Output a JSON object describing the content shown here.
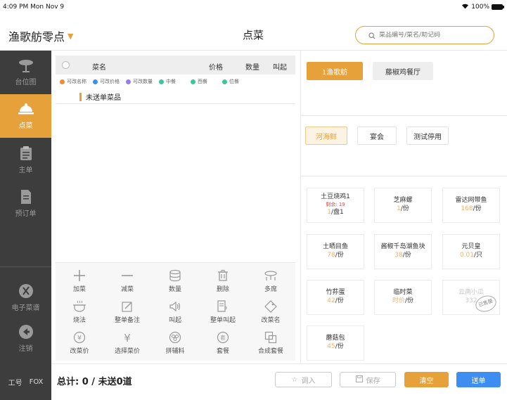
{
  "status_bar": {
    "time": "4:09 PM",
    "date": "Mon Nov 9",
    "battery": "100%"
  },
  "header": {
    "store_name": "渔歌舫零点",
    "title": "点菜",
    "search_placeholder": "菜品编号/菜名/助记码"
  },
  "sidebar": {
    "items": [
      {
        "label": "台位图",
        "icon": "table-icon"
      },
      {
        "label": "点菜",
        "icon": "dish-cover-icon",
        "active": true
      },
      {
        "label": "主单",
        "icon": "clipboard-icon"
      },
      {
        "label": "预订单",
        "icon": "document-icon"
      },
      {
        "label": "电子菜谱",
        "icon": "fork-knife-icon"
      },
      {
        "label": "注销",
        "icon": "logout-icon"
      }
    ],
    "footer": {
      "label": "工号",
      "user": "FOX"
    }
  },
  "order": {
    "columns": {
      "name": "菜名",
      "price": "价格",
      "qty": "数量",
      "call": "叫起"
    },
    "legend": [
      {
        "label": "可改名称",
        "color": "#f28a3c"
      },
      {
        "label": "可改价格",
        "color": "#3d8ef0"
      },
      {
        "label": "可改数量",
        "color": "#9b7be8"
      },
      {
        "label": "中餐",
        "color": "#3cc4a0"
      },
      {
        "label": "西餐",
        "color": "#3cc4a0"
      },
      {
        "label": "位餐",
        "color": "#3cc4a0"
      }
    ],
    "unsent_label": "未送单菜品"
  },
  "actions": [
    {
      "label": "加菜",
      "icon": "plus-icon"
    },
    {
      "label": "减菜",
      "icon": "minus-icon"
    },
    {
      "label": "数量",
      "icon": "stack-icon"
    },
    {
      "label": "删除",
      "icon": "trash-icon"
    },
    {
      "label": "多席",
      "icon": "multi-table-icon"
    },
    {
      "label": "烧法",
      "icon": "pot-icon"
    },
    {
      "label": "整单备注",
      "icon": "edit-icon"
    },
    {
      "label": "叫起",
      "icon": "speaker-icon"
    },
    {
      "label": "整单叫起",
      "icon": "order-speaker-icon"
    },
    {
      "label": "改菜名",
      "icon": "tag-icon"
    },
    {
      "label": "改菜价",
      "icon": "yen-circle-icon"
    },
    {
      "label": "选择菜价",
      "icon": "yen-icon"
    },
    {
      "label": "拼辅料",
      "icon": "mix-icon"
    },
    {
      "label": "套餐",
      "icon": "set-meal-icon"
    },
    {
      "label": "合成套餐",
      "icon": "combine-icon"
    }
  ],
  "bottom": {
    "total_label": "总计:",
    "total_count": "0",
    "separator": " / ",
    "unsent_text": "未送0道",
    "import_label": "调入",
    "save_label": "保存",
    "clear_label": "清空",
    "send_label": "送单"
  },
  "menu": {
    "restaurants": [
      {
        "label": "1渔歌舫",
        "active": true
      },
      {
        "label": "藤椒鸡餐厅",
        "active": false
      }
    ],
    "categories": [
      {
        "label": "河海鲜",
        "active": true
      },
      {
        "label": "宴会",
        "active": false
      },
      {
        "label": "测试停用",
        "active": false
      }
    ],
    "dishes": [
      {
        "name": "土豆烧鸡1",
        "remain": "剩余: 19",
        "price": "1",
        "unit": "/盘1"
      },
      {
        "name": "芝麻螺",
        "price": "1",
        "unit": "/份"
      },
      {
        "name": "雷达网带鱼",
        "price": "168",
        "unit": "/份"
      },
      {
        "name": "土晒目鱼",
        "price": "78",
        "unit": "/份"
      },
      {
        "name": "酱椒千岛湖鱼块",
        "price": "38",
        "unit": "/份"
      },
      {
        "name": "元贝皇",
        "price": "0.01",
        "unit": "/只"
      },
      {
        "name": "竹荪蛋",
        "price": "42",
        "unit": "/份"
      },
      {
        "name": "临时菜",
        "price": "时价",
        "unit": "/份"
      },
      {
        "name": "云南小瓜",
        "price": "332",
        "unit": "",
        "stamp": "已售罄"
      },
      {
        "name": "蘑菇包",
        "price": "45",
        "unit": "/份"
      }
    ]
  },
  "colors": {
    "accent": "#e6a13a",
    "sidebar": "#3d3d3d",
    "send": "#3d8ef0",
    "price": "#f0b26a"
  }
}
